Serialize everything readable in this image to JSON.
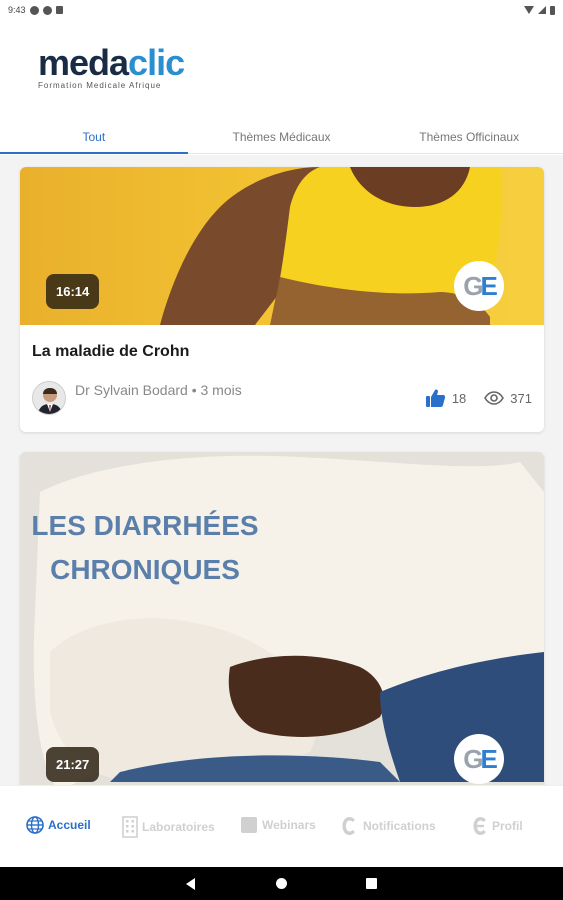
{
  "status_bar": {
    "time": "9:43"
  },
  "header": {
    "logo_part1": "meda",
    "logo_part2": "clic",
    "tagline": "Formation Medicale Afrique"
  },
  "tabs": [
    {
      "label": "Tout",
      "active": true
    },
    {
      "label": "Thèmes Médicaux",
      "active": false
    },
    {
      "label": "Thèmes Officinaux",
      "active": false
    }
  ],
  "cards": [
    {
      "duration": "16:14",
      "badge": {
        "g": "G",
        "e": "E"
      },
      "title": "La maladie de Crohn",
      "author": "Dr Sylvain  Bodard • 3 mois",
      "likes": "18",
      "views": "371"
    },
    {
      "overlay_line1": "LES DIARRHÉES",
      "overlay_line2": "CHRONIQUES",
      "duration": "21:27",
      "badge": {
        "g": "G",
        "e": "E"
      }
    }
  ],
  "bottom_nav": [
    {
      "label": "Accueil",
      "icon": "globe-icon",
      "active": true
    },
    {
      "label": "Laboratoires",
      "icon": "building-icon",
      "active": false
    },
    {
      "label": "Webinars",
      "icon": "video-icon",
      "active": false
    },
    {
      "label": "Notifications",
      "icon": "bell-icon",
      "active": false
    },
    {
      "label": "Profil",
      "icon": "profile-icon",
      "active": false
    }
  ],
  "colors": {
    "accent": "#2a6fc9",
    "logo_dark": "#1a2b45",
    "logo_light": "#2a8fd0",
    "overlay_text": "#5b7fab"
  }
}
